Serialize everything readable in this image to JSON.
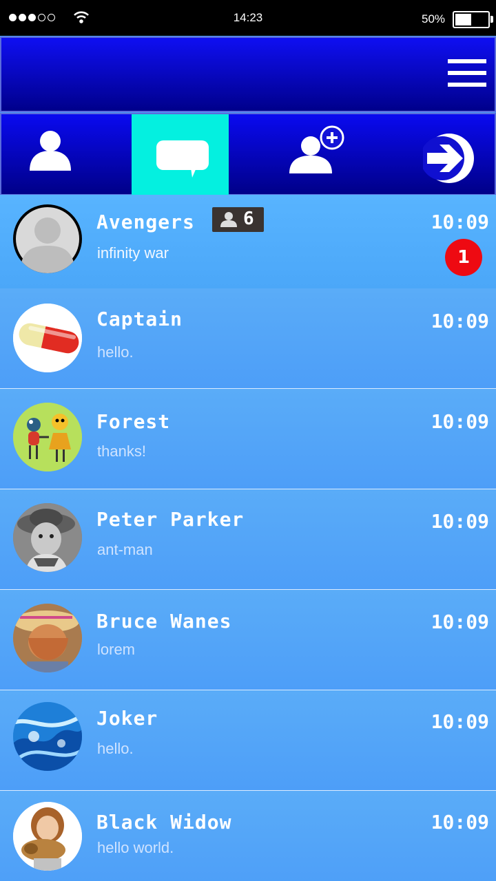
{
  "status_bar": {
    "time": "14:23",
    "battery_percent_label": "50%",
    "battery_level": 0.5,
    "signal_strength_of_5": 3
  },
  "header": {
    "menu_icon": "hamburger-menu-icon"
  },
  "tabs": [
    {
      "id": "contacts",
      "icon": "person-icon",
      "active": false
    },
    {
      "id": "chats",
      "icon": "chat-bubble-icon",
      "active": true
    },
    {
      "id": "add-contact",
      "icon": "add-person-icon",
      "active": false
    },
    {
      "id": "logout",
      "icon": "exit-arrow-icon",
      "active": false
    }
  ],
  "chats": [
    {
      "name": "Avengers",
      "message": "infinity war",
      "time": "10:09",
      "group_members": "6",
      "unread": "1",
      "avatar": "default-avatar"
    },
    {
      "name": "Captain",
      "message": "hello.",
      "time": "10:09",
      "avatar": "pill-avatar"
    },
    {
      "name": "Forest",
      "message": "thanks!",
      "time": "10:09",
      "avatar": "toy-figures-avatar"
    },
    {
      "name": "Peter Parker",
      "message": "ant-man",
      "time": "10:09",
      "avatar": "child-cowboy-hat-avatar"
    },
    {
      "name": "Bruce Wanes",
      "message": "lorem",
      "time": "10:09",
      "avatar": "child-straw-hat-avatar"
    },
    {
      "name": "Joker",
      "message": "hello.",
      "time": "10:09",
      "avatar": "water-splash-avatar"
    },
    {
      "name": "Black Widow",
      "message": "hello world.",
      "time": "10:09",
      "avatar": "girl-with-puppy-avatar"
    }
  ],
  "colors": {
    "header_blue": "#0f0ff2",
    "active_tab": "#04f0e0",
    "list_background": "#4d9ef8",
    "unread_badge": "#ee0a12",
    "member_badge": "#3a3330"
  }
}
